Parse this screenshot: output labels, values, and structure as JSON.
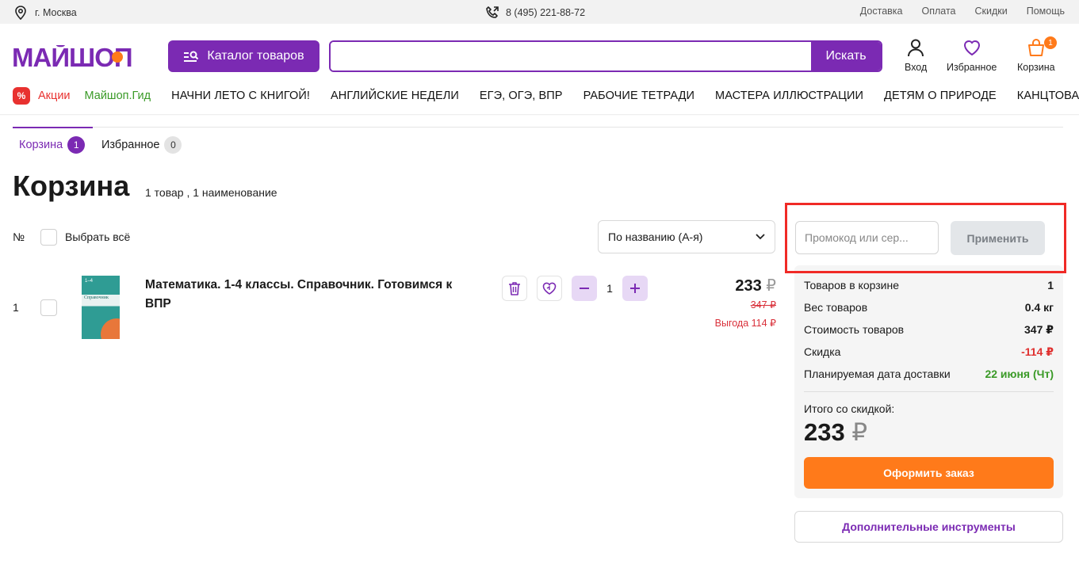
{
  "topbar": {
    "city": "г. Москва",
    "phone": "8 (495) 221-88-72",
    "links": [
      "Доставка",
      "Оплата",
      "Скидки",
      "Помощь"
    ]
  },
  "header": {
    "logo_text": "МАЙШОП",
    "catalog_label": "Каталог товаров",
    "search_placeholder": "",
    "search_button": "Искать",
    "login_label": "Вход",
    "favorites_label": "Избранное",
    "cart_label": "Корзина",
    "cart_count": "1"
  },
  "nav": {
    "promo_badge": "%",
    "promo_label": "Акции",
    "guide_label": "Майшоп.Гид",
    "categories": [
      "НАЧНИ ЛЕТО С КНИГОЙ!",
      "АНГЛИЙСКИЕ НЕДЕЛИ",
      "ЕГЭ, ОГЭ, ВПР",
      "РАБОЧИЕ ТЕТРАДИ",
      "МАСТЕРА ИЛЛЮСТРАЦИИ",
      "ДЕТЯМ О ПРИРОДЕ",
      "КАНЦТОВАРЫ"
    ]
  },
  "tabs": [
    {
      "label": "Корзина",
      "count": "1"
    },
    {
      "label": "Избранное",
      "count": "0"
    }
  ],
  "page": {
    "title": "Корзина",
    "subtitle": "1 товар , 1 наименование"
  },
  "list": {
    "number_header": "№",
    "select_all": "Выбрать всё",
    "sort_value": "По названию (А-я)"
  },
  "item": {
    "index": "1",
    "cover_top": "1–4",
    "cover_text": "Справочник",
    "title": "Математика. 1-4 классы. Справочник. Готовимся к ВПР",
    "quantity": "1",
    "price": "233",
    "currency": "₽",
    "old_price": "347 ₽",
    "savings": "Выгода 114 ₽"
  },
  "promo": {
    "placeholder": "Промокод или сер...",
    "apply_label": "Применить"
  },
  "summary": {
    "rows": [
      {
        "label": "Товаров в корзине",
        "value": "1"
      },
      {
        "label": "Вес товаров",
        "value": "0.4 кг"
      },
      {
        "label": "Стоимость товаров",
        "value": "347 ₽"
      },
      {
        "label": "Скидка",
        "value": "-114 ₽"
      },
      {
        "label": "Планируемая дата доставки",
        "value": "22 июня (Чт)"
      }
    ],
    "total_label": "Итого со скидкой:",
    "total_value": "233",
    "total_currency": "₽",
    "checkout_label": "Оформить заказ",
    "tools_label": "Дополнительные инструменты"
  },
  "colors": {
    "brand_purple": "#7b2ab3",
    "accent_orange": "#ff7a1a",
    "sale_red": "#e0302f",
    "green": "#3a9a27",
    "highlight": "#f02a26"
  }
}
